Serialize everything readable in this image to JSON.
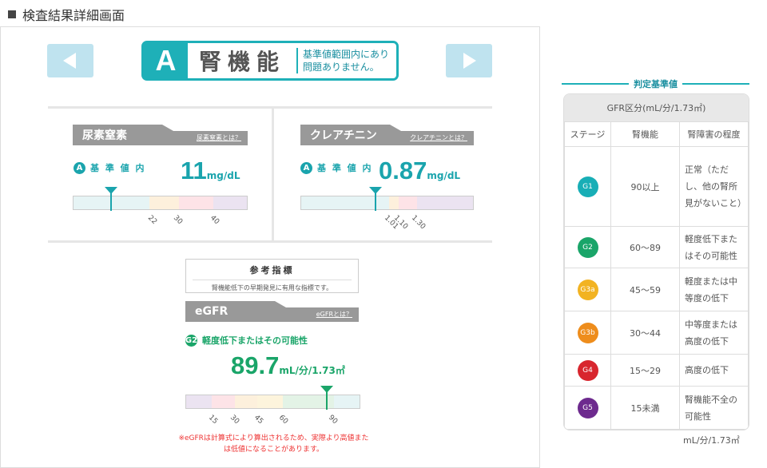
{
  "header": {
    "title": "検査結果詳細画面"
  },
  "title": {
    "grade": "A",
    "name": "腎機能",
    "message": "基準値範囲内にあり問題ありません。"
  },
  "urea": {
    "name": "尿素窒素",
    "link": "尿素窒素とは？",
    "grade": "A",
    "status": "基 準 値 内",
    "value": "11",
    "unit": "mg/dL",
    "ticks": [
      "22",
      "30",
      "40"
    ],
    "colors": [
      "#e6f4f5",
      "#fdf0dc",
      "#fde3e7",
      "#ebe3f1"
    ]
  },
  "creatinine": {
    "name": "クレアチニン",
    "link": "クレアチニンとは？",
    "grade": "A",
    "status": "基 準 値 内",
    "value": "0.87",
    "unit": "mg/dL",
    "ticks": [
      "1.01",
      "1.10",
      "1.30"
    ],
    "colors": [
      "#e6f4f5",
      "#fdf0dc",
      "#fde3e7",
      "#ebe3f1"
    ]
  },
  "reference": {
    "title": "参考指標",
    "subtitle": "腎機能低下の早期発見に有用な指標です。"
  },
  "egfr": {
    "name": "eGFR",
    "link": "eGFRとは？",
    "grade": "G2",
    "status": "軽度低下またはその可能性",
    "value": "89.7",
    "unit": "mL/分/1.73㎡",
    "ticks": [
      "15",
      "30",
      "45",
      "60",
      "90"
    ],
    "colors": [
      "#ebe3f1",
      "#fde3e7",
      "#fdf0dc",
      "#fdf4dc",
      "#e3f3e6",
      "#e6f4f5"
    ],
    "note": "※eGFRは計算式により算出されるため、実際より高値または低値になることがあります。"
  },
  "standard": {
    "title": "判定基準値",
    "header": "GFR区分(mL/分/1.73㎡)",
    "columns": [
      "ステージ",
      "腎機能",
      "腎障害の程度"
    ],
    "rows": [
      {
        "stage": "G1",
        "range": "90以上",
        "desc": "正常（ただし、他の腎所見がないこと）",
        "color": "#18aeb6"
      },
      {
        "stage": "G2",
        "range": "60〜89",
        "desc": "軽度低下またはその可能性",
        "color": "#1aa569"
      },
      {
        "stage": "G3a",
        "range": "45〜59",
        "desc": "軽度または中等度の低下",
        "color": "#f2b322"
      },
      {
        "stage": "G3b",
        "range": "30〜44",
        "desc": "中等度または高度の低下",
        "color": "#ee8d1c"
      },
      {
        "stage": "G4",
        "range": "15〜29",
        "desc": "高度の低下",
        "color": "#d8262e"
      },
      {
        "stage": "G5",
        "range": "15未満",
        "desc": "腎機能不全の可能性",
        "color": "#6d2a8e"
      }
    ],
    "unit": "mL/分/1.73㎡"
  }
}
